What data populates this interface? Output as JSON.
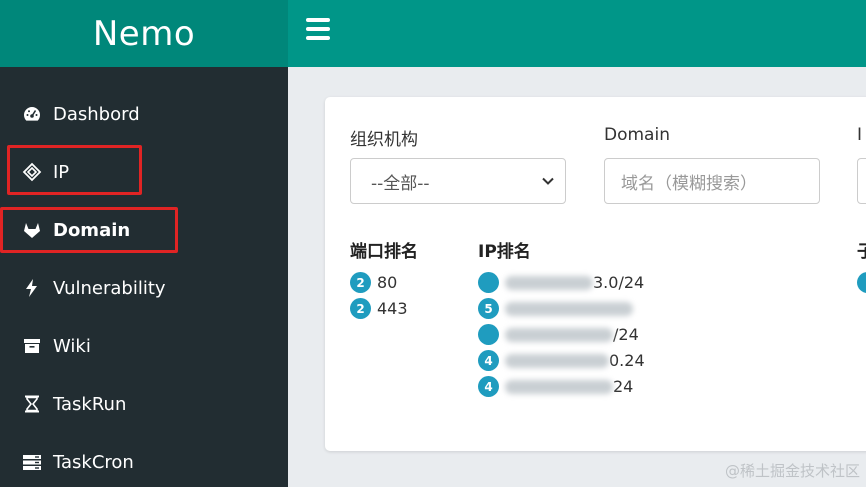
{
  "app": {
    "brand": "Nemo"
  },
  "sidebar": {
    "items": [
      {
        "label": "Dashbord",
        "icon": "dashboard-icon",
        "highlighted": false,
        "active": false
      },
      {
        "label": "IP",
        "icon": "ip-icon",
        "highlighted": true,
        "active": false
      },
      {
        "label": "Domain",
        "icon": "gitlab-icon",
        "highlighted": true,
        "active": true
      },
      {
        "label": "Vulnerability",
        "icon": "bolt-icon",
        "highlighted": false,
        "active": false
      },
      {
        "label": "Wiki",
        "icon": "archive-icon",
        "highlighted": false,
        "active": false
      },
      {
        "label": "TaskRun",
        "icon": "hourglass-icon",
        "highlighted": false,
        "active": false
      },
      {
        "label": "TaskCron",
        "icon": "server-icon",
        "highlighted": false,
        "active": false
      }
    ]
  },
  "topbar": {
    "menu_icon": "menu-icon"
  },
  "filters": {
    "org_label": "组织机构",
    "org_selected": "--全部--",
    "domain_label": "Domain",
    "domain_placeholder": "域名（模糊搜索）",
    "third_label_partial": "I"
  },
  "port_rank": {
    "title": "端口排名",
    "items": [
      {
        "count": "2",
        "value": "80"
      },
      {
        "count": "2",
        "value": "443"
      }
    ]
  },
  "ip_rank": {
    "title": "IP排名",
    "items": [
      {
        "count": "",
        "visible_text": "3.0/24"
      },
      {
        "count": "5",
        "visible_text": ""
      },
      {
        "count": "",
        "visible_text": "/24"
      },
      {
        "count": "4",
        "visible_text": "0.24"
      },
      {
        "count": "4",
        "visible_text": "24"
      }
    ]
  },
  "third_rank": {
    "title_partial": "子",
    "badge": ""
  },
  "colors": {
    "brand_bg": "#00877a",
    "topbar_bg": "#009688",
    "sidebar_bg": "#222d32",
    "badge_bg": "#1f9cbf",
    "highlight_border": "#e02424"
  },
  "watermark": "@稀土掘金技术社区"
}
